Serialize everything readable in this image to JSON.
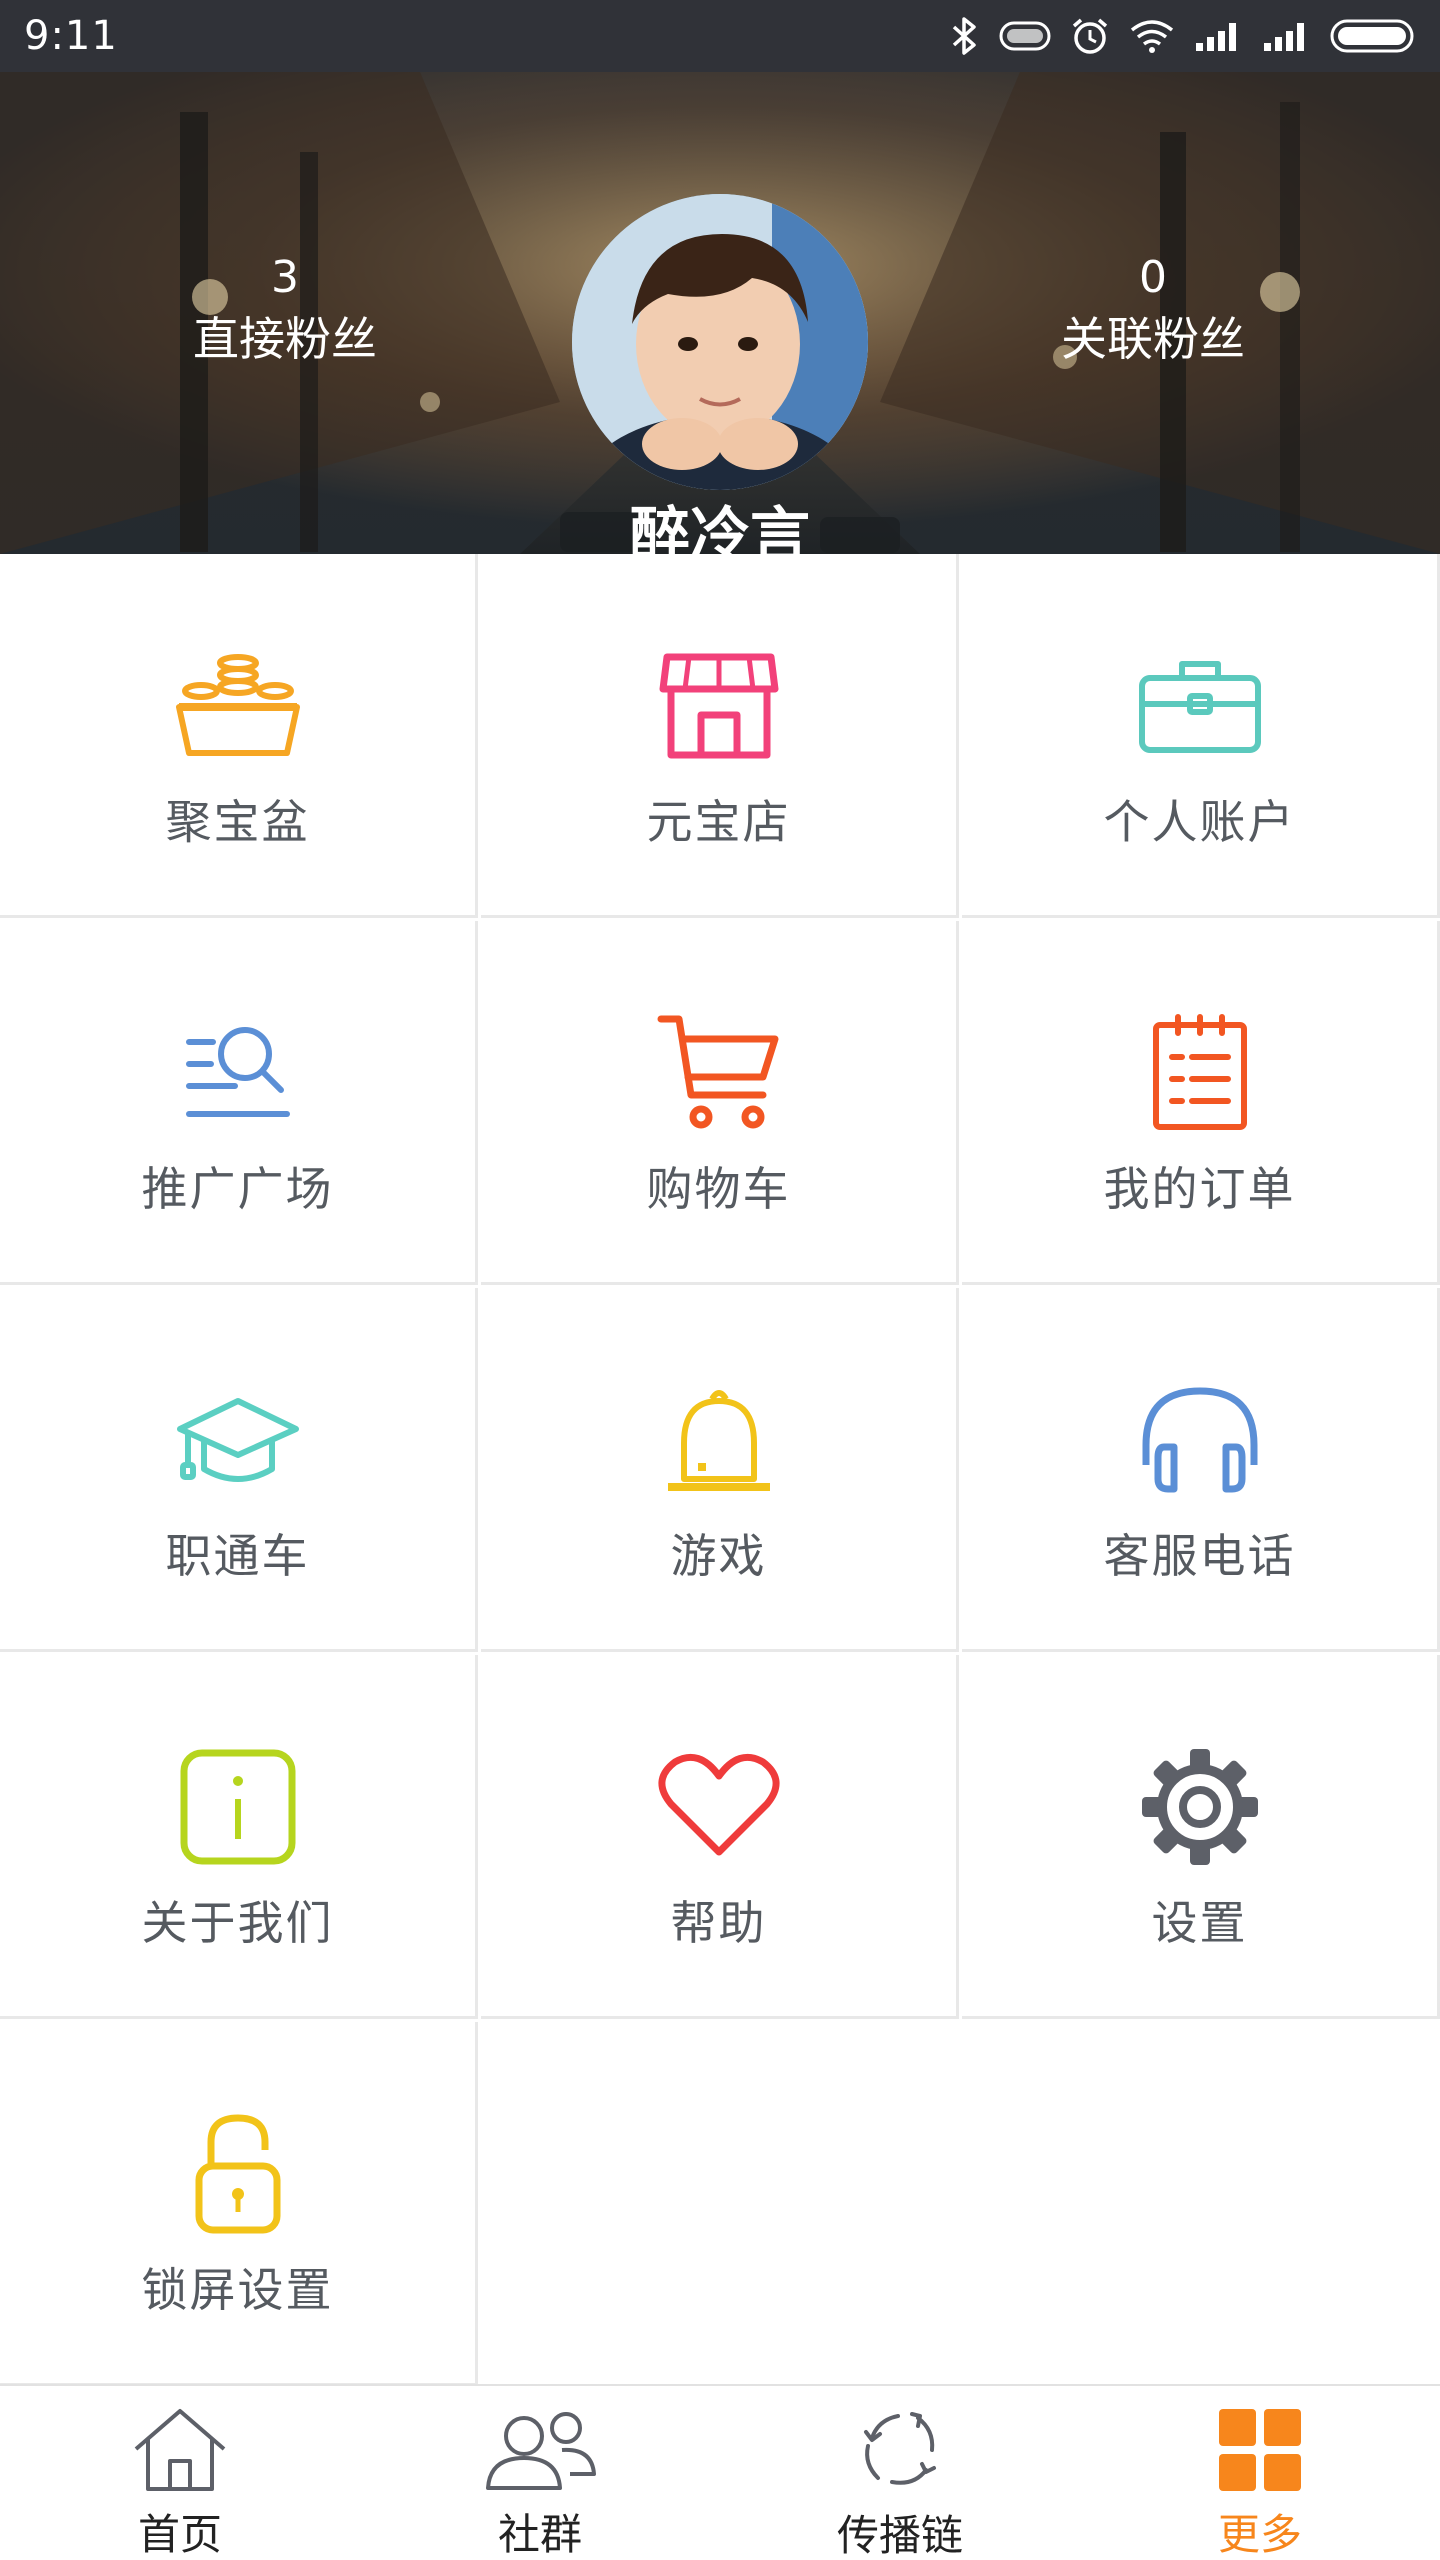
{
  "status_bar": {
    "time": "9:11",
    "icons": [
      "bluetooth-icon",
      "vibrate-icon",
      "alarm-icon",
      "wifi-icon",
      "signal-icon",
      "signal-icon",
      "battery-icon"
    ]
  },
  "header": {
    "left_stat": {
      "value": "3",
      "label": "直接粉丝"
    },
    "right_stat": {
      "value": "0",
      "label": "关联粉丝"
    },
    "user_name": "醉冷言"
  },
  "menu": [
    {
      "label": "聚宝盆",
      "icon": "treasure-bowl-icon",
      "color": "#f6a623"
    },
    {
      "label": "元宝店",
      "icon": "shop-icon",
      "color": "#f2417a"
    },
    {
      "label": "个人账户",
      "icon": "briefcase-icon",
      "color": "#5bc9bd"
    },
    {
      "label": "推广广场",
      "icon": "search-list-icon",
      "color": "#5b8fd6"
    },
    {
      "label": "购物车",
      "icon": "cart-icon",
      "color": "#f25622"
    },
    {
      "label": "我的订单",
      "icon": "order-icon",
      "color": "#f25622"
    },
    {
      "label": "职通车",
      "icon": "graduation-cap-icon",
      "color": "#5bcfc2"
    },
    {
      "label": "游戏",
      "icon": "bell-icon",
      "color": "#f2c319"
    },
    {
      "label": "客服电话",
      "icon": "headphones-icon",
      "color": "#5b8fd6"
    },
    {
      "label": "关于我们",
      "icon": "info-icon",
      "color": "#b6d51e"
    },
    {
      "label": "帮助",
      "icon": "heart-icon",
      "color": "#ef3b3b"
    },
    {
      "label": "设置",
      "icon": "gear-icon",
      "color": "#5d6068"
    },
    {
      "label": "锁屏设置",
      "icon": "lock-icon",
      "color": "#f2c319"
    }
  ],
  "bottom_nav": [
    {
      "label": "首页",
      "icon": "home-icon",
      "active": false
    },
    {
      "label": "社群",
      "icon": "group-icon",
      "active": false
    },
    {
      "label": "传播链",
      "icon": "share-cycle-icon",
      "active": false
    },
    {
      "label": "更多",
      "icon": "grid-icon",
      "active": true
    }
  ],
  "colors": {
    "status_bar": "#303238",
    "accent": "#f7861c",
    "label_text": "#555a60",
    "divider": "#e8e8e8"
  }
}
